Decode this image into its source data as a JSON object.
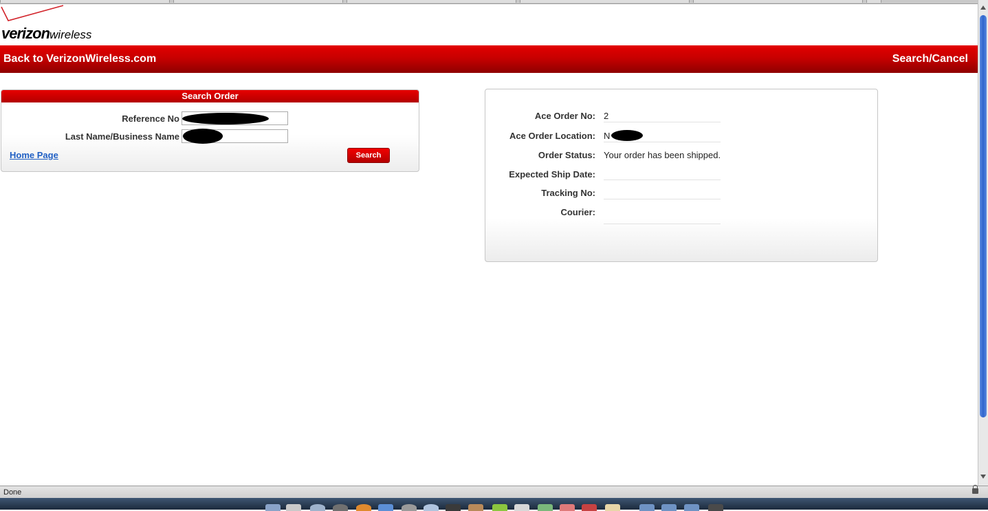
{
  "statusbar": {
    "text": "Done"
  },
  "logo": {
    "brand": "verizon",
    "suffix": "wireless"
  },
  "navbar": {
    "back_label": "Back to VerizonWireless.com",
    "cancel_label": "Search/Cancel"
  },
  "search_order": {
    "title": "Search Order",
    "reference_label": "Reference No",
    "lastname_label": "Last Name/Business Name",
    "home_link": "Home Page",
    "search_button": "Search"
  },
  "order_details": {
    "rows": [
      {
        "label": "Ace Order No:",
        "value": "2"
      },
      {
        "label": "Ace Order Location:",
        "value": "N"
      },
      {
        "label": "Order Status:",
        "value": "Your order has been shipped."
      },
      {
        "label": "Expected Ship Date:",
        "value": ""
      },
      {
        "label": "Tracking No:",
        "value": ""
      },
      {
        "label": "Courier:",
        "value": ""
      }
    ]
  },
  "colors": {
    "brand_red": "#cd040b",
    "link_blue": "#1f5fc4",
    "scroll_blue": "#2f64cc"
  }
}
